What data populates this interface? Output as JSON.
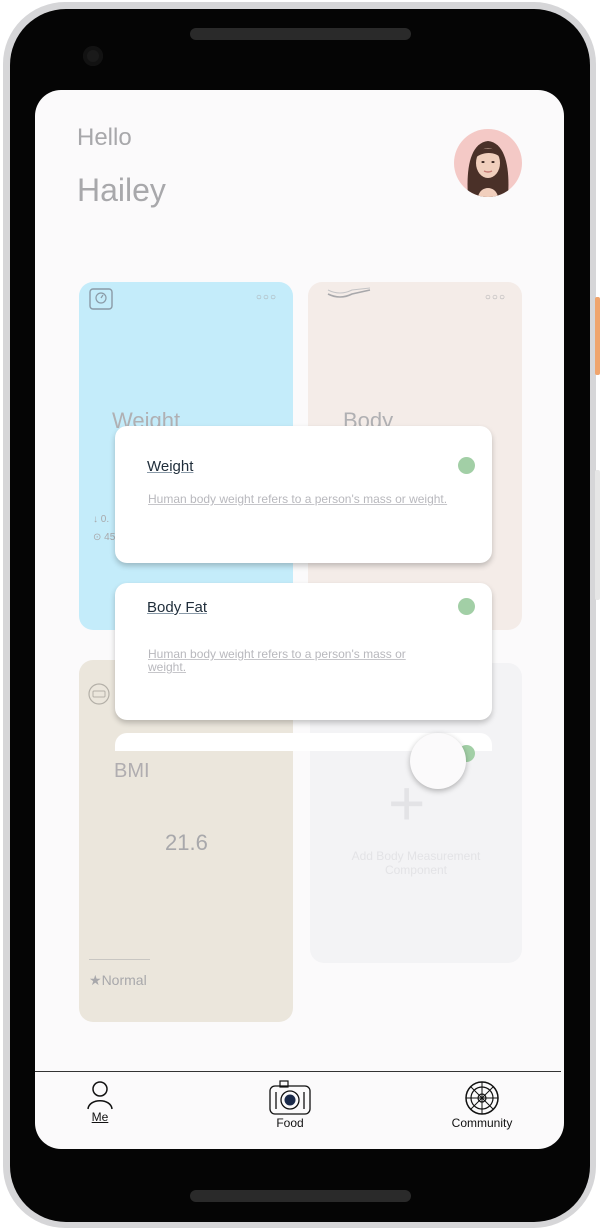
{
  "header": {
    "greeting": "Hello",
    "username": "Hailey"
  },
  "cards": {
    "weight": {
      "title": "Weight",
      "stat_1": "↓ 0.",
      "stat_2": "⊙ 45"
    },
    "body": {
      "title": "Body"
    },
    "bmi": {
      "title": "BMI",
      "value": "21.6",
      "status": "Normal"
    },
    "add": {
      "label": "Add Body Measurement Component"
    }
  },
  "measurement_list": [
    {
      "title": "Weight",
      "description": "Human body weight refers to a person's mass or weight."
    },
    {
      "title": "Body Fat",
      "description": "Human body weight refers to a person's mass or weight."
    }
  ],
  "nav": {
    "me": "Me",
    "food": "Food",
    "community": "Community"
  },
  "colors": {
    "weight_card": "#c4ecfa",
    "body_card": "#f4ece8",
    "bmi_card": "#ebe6dc",
    "toggle_on": "#a2cfa6",
    "side_button": "#f0a56d"
  },
  "icons": {
    "weight_card": "scale-icon",
    "body_card": "tape-icon",
    "bmi_card": "bmi-badge-icon",
    "me": "person-icon",
    "food": "plate-icon",
    "community": "wheel-icon"
  }
}
